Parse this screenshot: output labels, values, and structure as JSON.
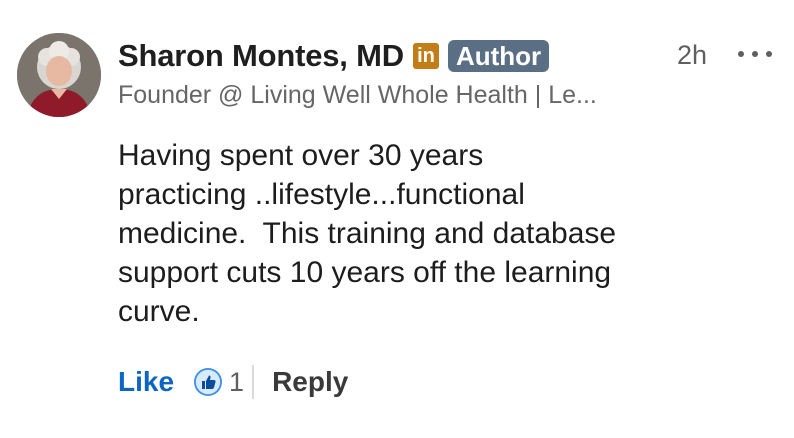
{
  "comment": {
    "author_name": "Sharon Montes, MD",
    "network_icon": "in",
    "badge": "Author",
    "timestamp": "2h",
    "headline": "Founder @ Living Well Whole Health | Le...",
    "body_lines": [
      "Having spent over 30 years",
      "practicing ..lifestyle...functional",
      "medicine.  This training and database",
      "support cuts 10 years off the learning",
      "curve."
    ],
    "actions": {
      "like_label": "Like",
      "reaction_count": "1",
      "reply_label": "Reply"
    }
  },
  "icons": {
    "avatar": "profile-photo",
    "network": "linkedin-icon",
    "more": "more-options-icon",
    "reaction": "like-reaction-icon"
  },
  "colors": {
    "like_blue": "#0a66c2",
    "badge_bg": "#5b6f84",
    "linkedin_badge": "#c37d16",
    "reaction_blue": "#378fe9"
  }
}
